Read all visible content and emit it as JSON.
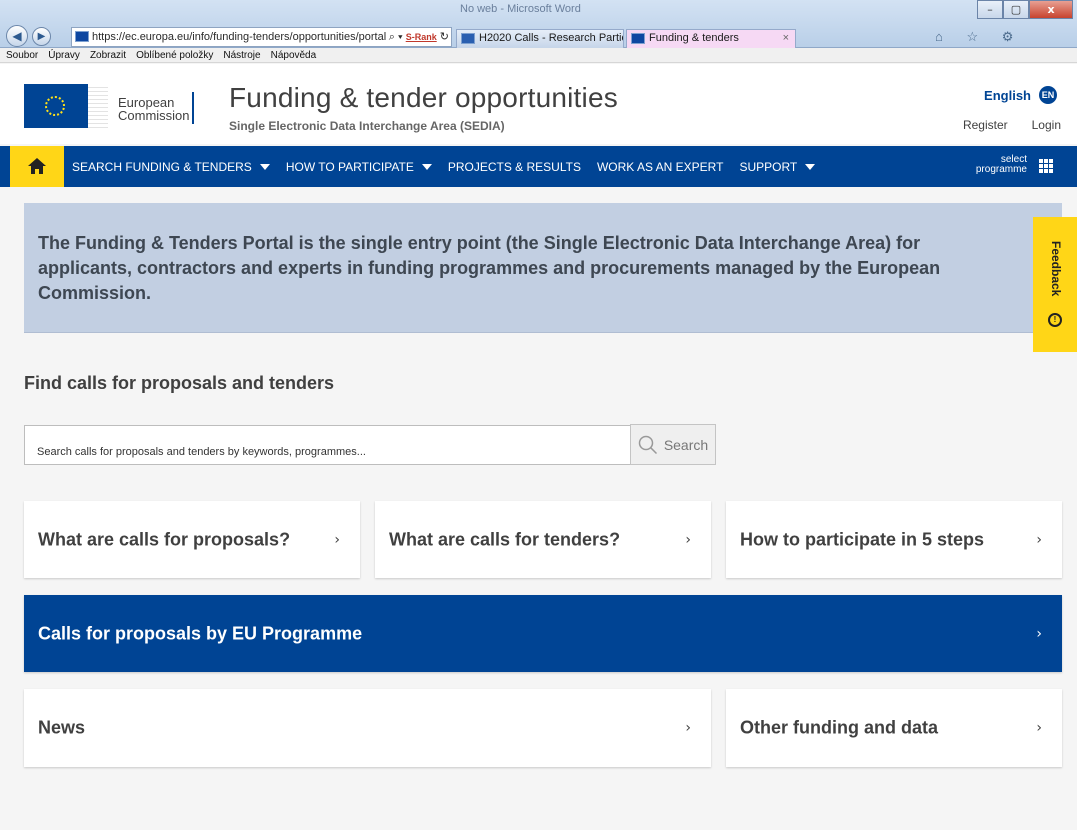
{
  "browser": {
    "window_title": "No web - Microsoft Word",
    "url": "https://ec.europa.eu/info/funding-tenders/opportunities/portal",
    "addr_tools": "⌕ ▾",
    "srank": "S-Rank",
    "tabs": [
      {
        "label": "H2020 Calls - Research Particip..."
      },
      {
        "label": "Funding & tenders",
        "close": "×"
      }
    ],
    "menu": [
      "Soubor",
      "Úpravy",
      "Zobrazit",
      "Oblíbené položky",
      "Nástroje",
      "Nápověda"
    ],
    "window_buttons": {
      "minimize": "–",
      "maximize": "▢",
      "close": "x"
    },
    "toolbar_icons": "⌂ ☆ ⚙"
  },
  "header": {
    "logo_line1": "European",
    "logo_line2": "Commission",
    "title": "Funding & tender opportunities",
    "subtitle": "Single Electronic Data Interchange Area (SEDIA)",
    "language": "English",
    "language_code": "EN",
    "register": "Register",
    "login": "Login"
  },
  "nav": {
    "items": [
      {
        "label": "SEARCH FUNDING & TENDERS",
        "dropdown": true
      },
      {
        "label": "HOW TO PARTICIPATE",
        "dropdown": true
      },
      {
        "label": "PROJECTS & RESULTS",
        "dropdown": false
      },
      {
        "label": "WORK AS AN EXPERT",
        "dropdown": false
      },
      {
        "label": "SUPPORT",
        "dropdown": true
      }
    ],
    "select_programme_line1": "select",
    "select_programme_line2": "programme"
  },
  "intro": {
    "text": "The Funding & Tenders Portal is the single entry point (the Single Electronic Data Interchange Area) for applicants, contractors and experts in funding programmes and procurements managed by the European Commission."
  },
  "feedback": {
    "label": "Feedback"
  },
  "search": {
    "heading": "Find calls for proposals and tenders",
    "placeholder": "Search calls for proposals and tenders by keywords, programmes...",
    "button": "Search"
  },
  "cards": {
    "proposals": "What are calls for proposals?",
    "tenders": "What are calls for tenders?",
    "participate": "How to participate in 5 steps",
    "programme": "Calls for proposals by EU Programme",
    "news": "News",
    "other": "Other funding and data",
    "chevron": "›"
  },
  "colors": {
    "eu_blue": "#004494",
    "eu_yellow": "#ffd617",
    "intro_bg": "#c2cfe2"
  }
}
